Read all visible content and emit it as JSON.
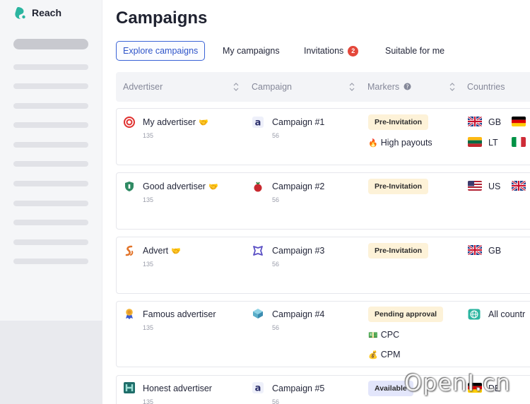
{
  "app": {
    "brand": "Reach"
  },
  "page": {
    "title": "Campaigns"
  },
  "tabs": [
    {
      "label": "Explore campaigns",
      "active": true
    },
    {
      "label": "My campaigns"
    },
    {
      "label": "Invitations",
      "badge": "2"
    },
    {
      "label": "Suitable for me"
    }
  ],
  "table": {
    "headers": {
      "advertiser": "Advertiser",
      "campaign": "Campaign",
      "markers": "Markers",
      "countries": "Countries"
    },
    "rows": [
      {
        "advertiser": "My advertiser",
        "advertiser_id": "135",
        "campaign": "Campaign #1",
        "campaign_id": "56",
        "marker": "Pre-Invitation",
        "extra_markers": [
          "High payouts"
        ],
        "countries": [
          [
            "GB",
            ""
          ],
          [
            "LT",
            ""
          ]
        ]
      },
      {
        "advertiser": "Good advertiser",
        "advertiser_id": "135",
        "campaign": "Campaign #2",
        "campaign_id": "56",
        "marker": "Pre-Invitation",
        "countries": [
          [
            "US",
            ""
          ]
        ]
      },
      {
        "advertiser": "Advert",
        "advertiser_id": "135",
        "campaign": "Campaign #3",
        "campaign_id": "56",
        "marker": "Pre-Invitation",
        "countries": [
          [
            "GB"
          ]
        ]
      },
      {
        "advertiser": "Famous advertiser",
        "advertiser_id": "135",
        "campaign": "Campaign #4",
        "campaign_id": "56",
        "marker": "Pending approval",
        "extra_markers": [
          "CPC",
          "CPM"
        ],
        "countries": [
          [
            "All countr"
          ]
        ]
      },
      {
        "advertiser": "Honest advertiser",
        "advertiser_id": "135",
        "campaign": "Campaign #5",
        "campaign_id": "56",
        "marker": "Available",
        "countries": [
          [
            "DE"
          ]
        ]
      }
    ]
  },
  "watermark": "OpenI.cn",
  "colors": {
    "accent": "#3a63d6",
    "badge": "#e4473a",
    "brand": "#2bb5a0"
  }
}
